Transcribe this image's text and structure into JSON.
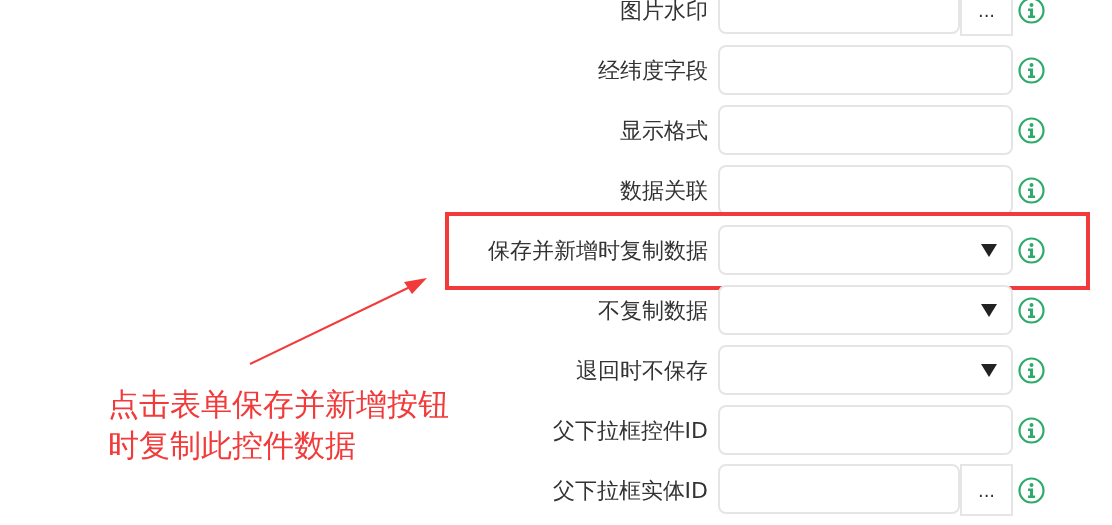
{
  "fields": [
    {
      "label": "图片水印",
      "kind": "text_button",
      "button": "...",
      "highlighted": false
    },
    {
      "label": "经纬度字段",
      "kind": "text",
      "highlighted": false
    },
    {
      "label": "显示格式",
      "kind": "text",
      "highlighted": false
    },
    {
      "label": "数据关联",
      "kind": "text",
      "highlighted": false
    },
    {
      "label": "保存并新增时复制数据",
      "kind": "select",
      "highlighted": true
    },
    {
      "label": "不复制数据",
      "kind": "select",
      "highlighted": false
    },
    {
      "label": "退回时不保存",
      "kind": "select",
      "highlighted": false
    },
    {
      "label": "父下拉框控件ID",
      "kind": "text",
      "highlighted": false
    },
    {
      "label": "父下拉框实体ID",
      "kind": "text_button",
      "button": "...",
      "highlighted": false
    }
  ],
  "annotation": {
    "lines": [
      "点击表单保存并新增按钮",
      "时复制此控件数据"
    ]
  }
}
